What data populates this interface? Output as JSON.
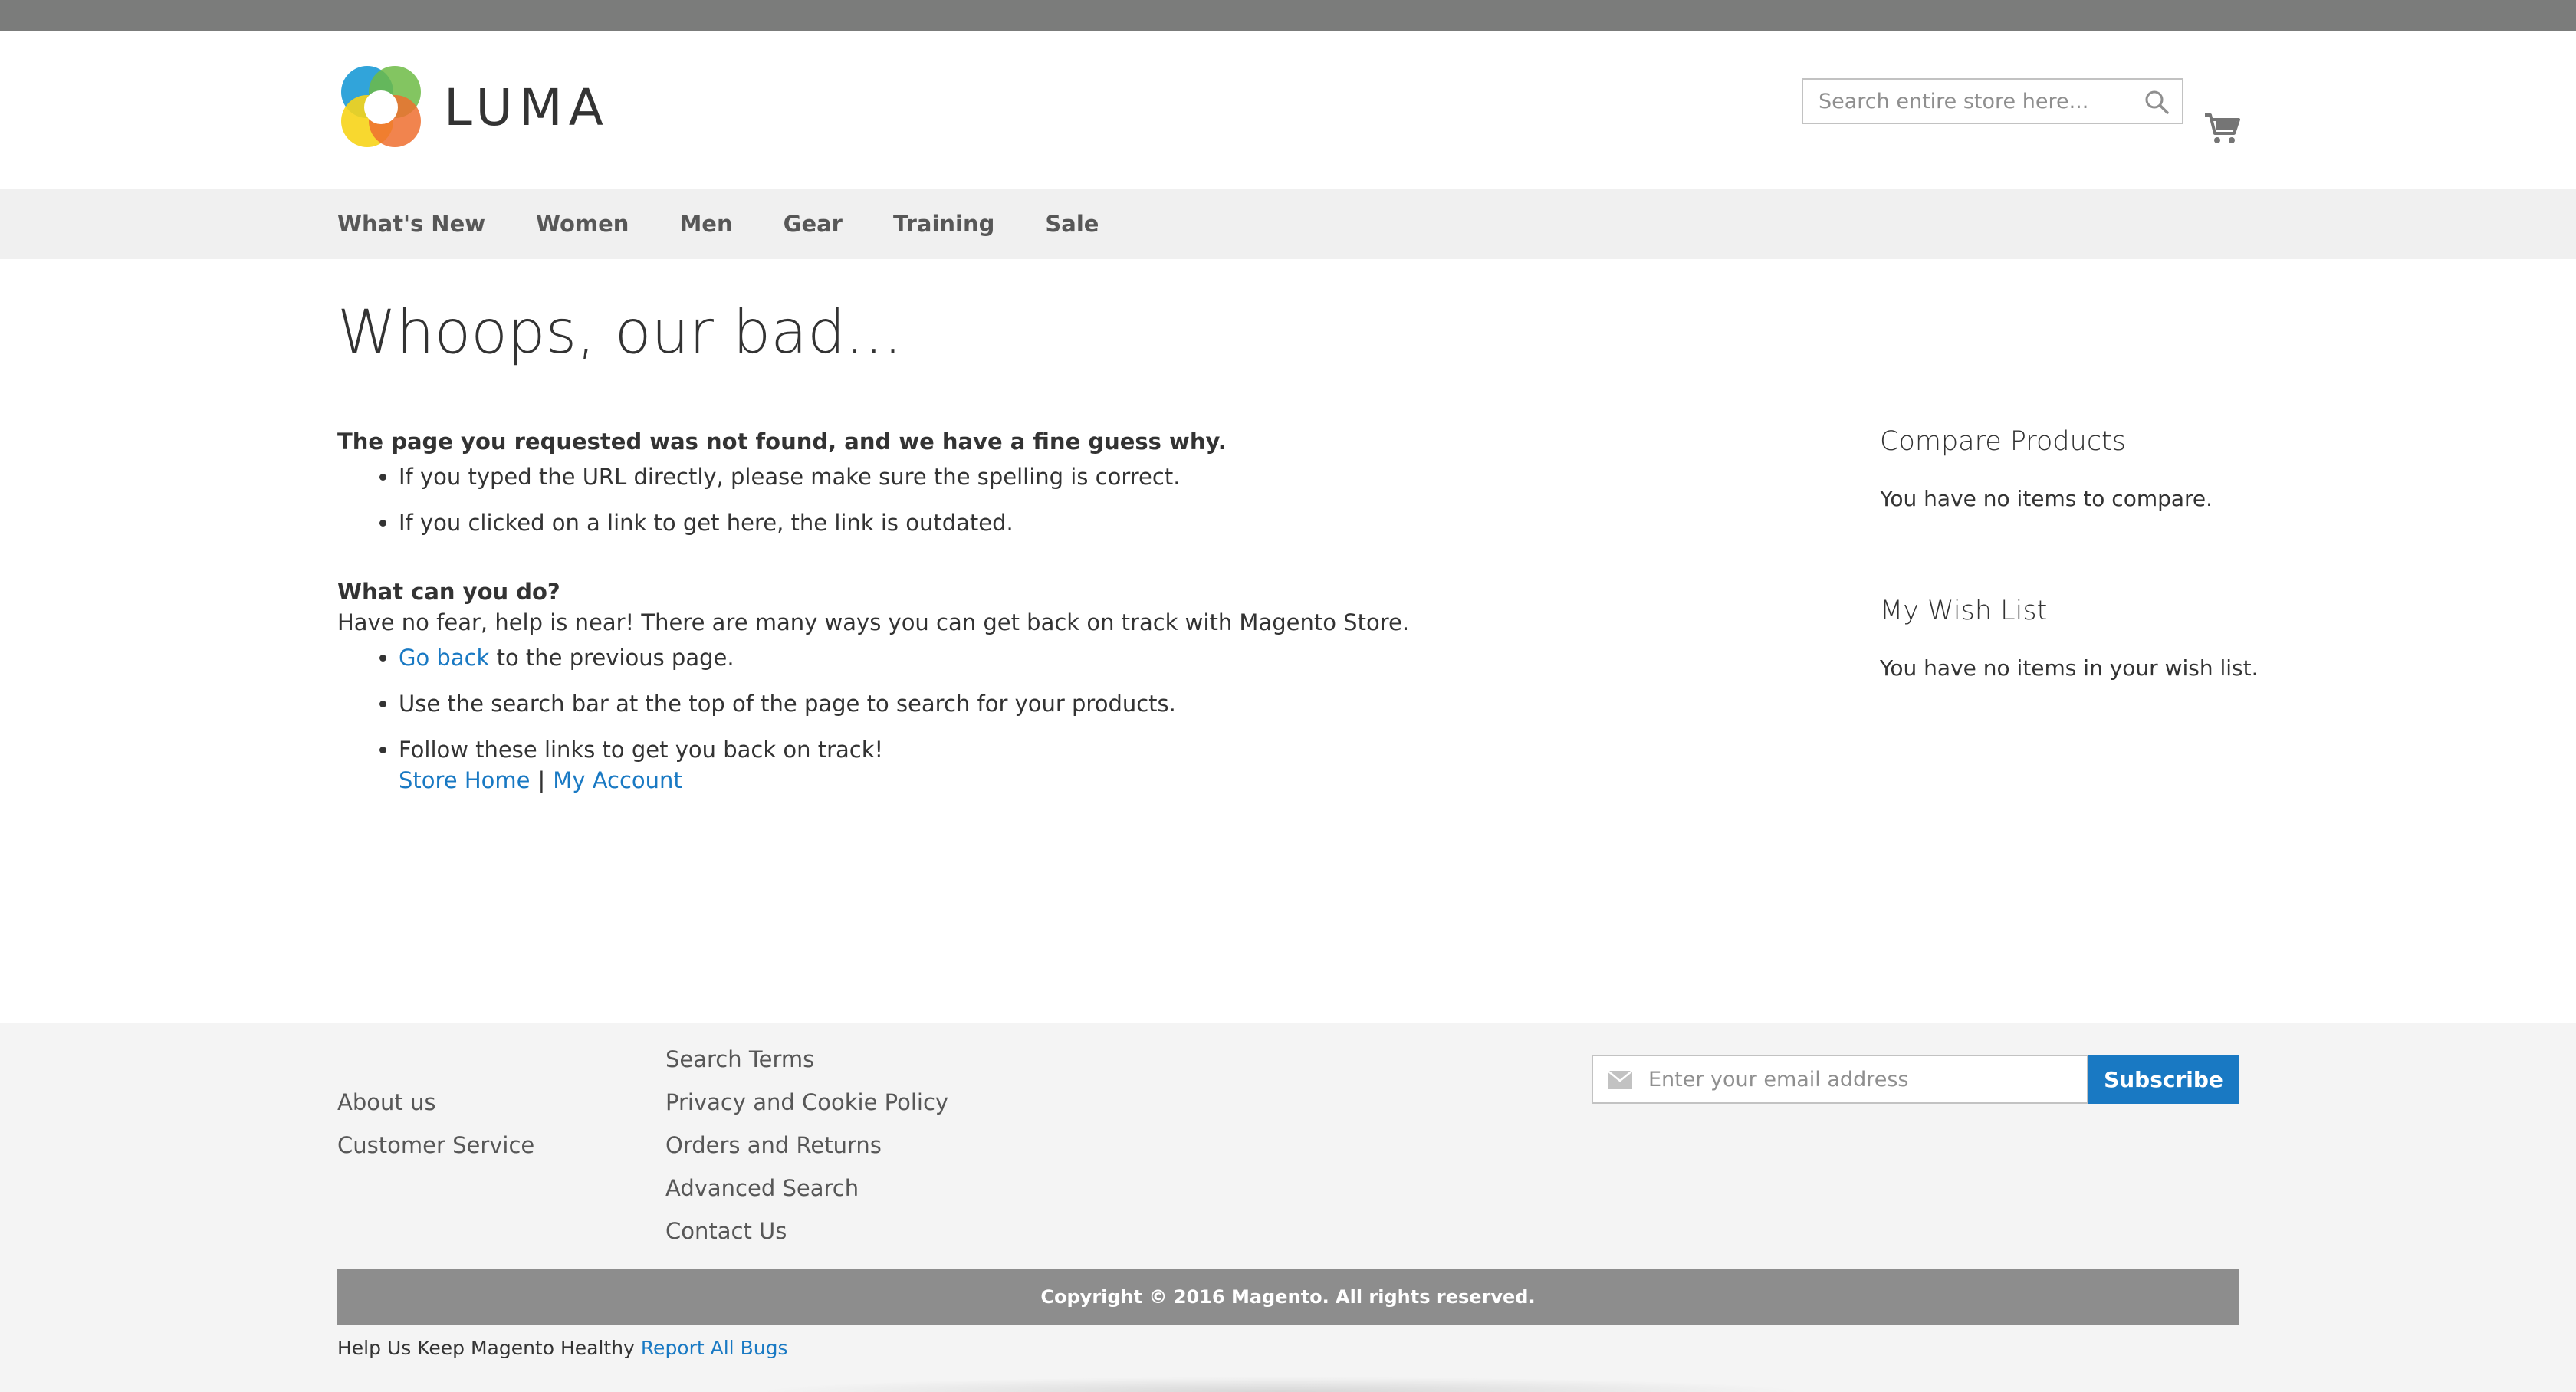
{
  "header": {
    "logo_text": "LUMA",
    "search_placeholder": "Search entire store here...",
    "icons": [
      "luma-logo-mark",
      "search-icon",
      "cart-icon"
    ]
  },
  "nav": {
    "items": [
      {
        "label": "What's New"
      },
      {
        "label": "Women"
      },
      {
        "label": "Men"
      },
      {
        "label": "Gear"
      },
      {
        "label": "Training"
      },
      {
        "label": "Sale"
      }
    ]
  },
  "main": {
    "title": "Whoops, our bad...",
    "intro_bold": "The page you requested was not found, and we have a fine guess why.",
    "reasons": [
      "If you typed the URL directly, please make sure the spelling is correct.",
      "If you clicked on a link to get here, the link is outdated."
    ],
    "what_heading": "What can you do?",
    "what_text": "Have no fear, help is near! There are many ways you can get back on track with Magento Store.",
    "go_back_link": "Go back",
    "go_back_rest": " to the previous page.",
    "search_tip": "Use the search bar at the top of the page to search for your products.",
    "follow_text": "Follow these links to get you back on track!",
    "store_home_link": "Store Home",
    "separator": "|",
    "my_account_link": "My Account"
  },
  "sidebar": {
    "compare_title": "Compare Products",
    "compare_empty": "You have no items to compare.",
    "wishlist_title": "My Wish List",
    "wishlist_empty": "You have no items in your wish list."
  },
  "footer": {
    "col1": [
      "About us",
      "Customer Service"
    ],
    "col2": [
      "Search Terms",
      "Privacy and Cookie Policy",
      "Orders and Returns",
      "Advanced Search",
      "Contact Us"
    ],
    "email_placeholder": "Enter your email address",
    "subscribe_label": "Subscribe",
    "copyright": "Copyright © 2016 Magento. All rights reserved.",
    "bugs_text": "Help Us Keep Magento Healthy",
    "bugs_link": "Report All Bugs"
  },
  "colors": {
    "accent": "#1979c3",
    "nav_bg": "#f0f0f0",
    "footer_bg": "#f4f4f4",
    "copyright_bg": "#8d8d8d"
  }
}
